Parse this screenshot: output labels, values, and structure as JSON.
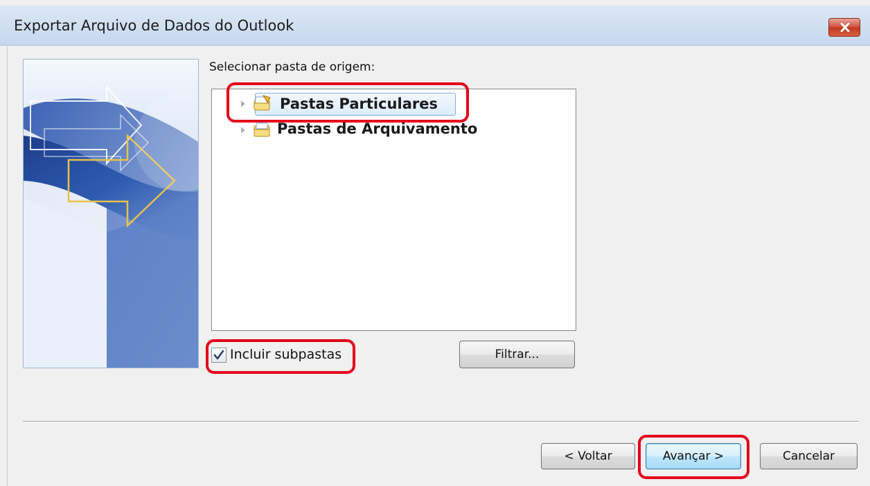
{
  "window": {
    "title": "Exportar Arquivo de Dados do Outlook"
  },
  "prompt": {
    "label": "Selecionar pasta de origem:"
  },
  "tree": {
    "items": [
      {
        "label": "Pastas Particulares",
        "selected": true,
        "icon": "personal-folders-icon"
      },
      {
        "label": "Pastas de Arquivamento",
        "selected": false,
        "icon": "archive-folders-icon"
      }
    ]
  },
  "options": {
    "include_subfolders_label": "Incluir subpastas",
    "include_subfolders_checked": true
  },
  "buttons": {
    "filter": "Filtrar...",
    "back": "< Voltar",
    "next": "Avançar >",
    "cancel": "Cancelar"
  },
  "colors": {
    "highlight": "#e3001b",
    "title_bar": "#c6d8ee",
    "selection": "#dcecfc"
  }
}
